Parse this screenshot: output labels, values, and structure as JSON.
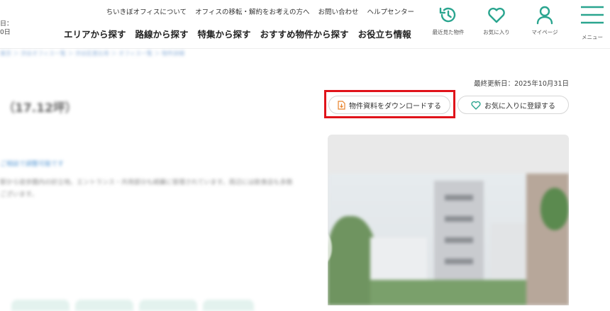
{
  "header": {
    "date_stub_line1": "日：",
    "date_stub_line2": "0日",
    "sub_nav": [
      "ちいきぼオフィスについて",
      "オフィスの移転・解約をお考えの方へ",
      "お問い合わせ",
      "ヘルプセンター"
    ],
    "main_nav": [
      "エリアから探す",
      "路線から探す",
      "特集から探す",
      "おすすめ物件から探す",
      "お役立ち情報"
    ],
    "icons": {
      "history_label": "最近見た物件",
      "favorites_label": "お気に入り",
      "mypage_label": "マイページ",
      "menu_label": "メニュー"
    }
  },
  "left": {
    "breadcrumb": "東京 ＞ 渋谷オフィス一覧 ＞ 渋谷区恵比寿 ＞ オフィス一覧 ＞ 物件詳細",
    "size_title": "（17.12坪）",
    "notice": "ご相談で調整可能です",
    "desc_line1": "駅から徒歩圏内の好立地。エントランス・共用部分も綺麗に管理されています。周辺には飲食店も多数",
    "desc_line2": "ございます。"
  },
  "right": {
    "updated": "最終更新日：2025年10月31日",
    "download_label": "物件資料をダウンロードする",
    "favorite_label": "お気に入りに登録する"
  },
  "colors": {
    "accent": "#2aa58f",
    "highlight": "#e0131a",
    "download_icon": "#e8832b"
  }
}
